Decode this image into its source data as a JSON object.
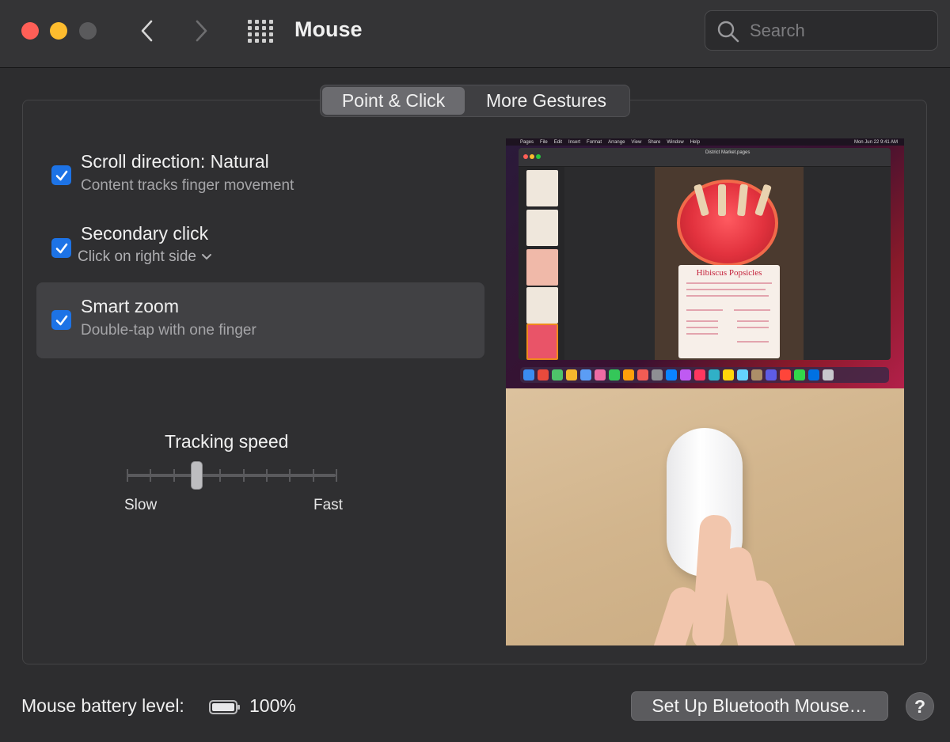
{
  "window": {
    "title": "Mouse",
    "search_placeholder": "Search"
  },
  "tabs": [
    {
      "label": "Point & Click",
      "active": true
    },
    {
      "label": "More Gestures",
      "active": false
    }
  ],
  "options": [
    {
      "title": "Scroll direction: Natural",
      "subtitle": "Content tracks finger movement",
      "checked": true
    },
    {
      "title": "Secondary click",
      "subtitle": "Click on right side",
      "checked": true,
      "has_dropdown": true
    },
    {
      "title": "Smart zoom",
      "subtitle": "Double-tap with one finger",
      "checked": true,
      "selected": true
    }
  ],
  "tracking": {
    "label": "Tracking speed",
    "min_label": "Slow",
    "max_label": "Fast",
    "ticks": 10,
    "position": 3
  },
  "preview": {
    "doc_title": "District Market.pages",
    "recipe_title": "Hibiscus Popsicles",
    "menu_items": [
      "Pages",
      "File",
      "Edit",
      "Insert",
      "Format",
      "Arrange",
      "View",
      "Share",
      "Window",
      "Help"
    ],
    "clock": "Mon Jun 22  9:41 AM"
  },
  "footer": {
    "battery_label": "Mouse battery level:",
    "battery_value": "100%",
    "setup_button": "Set Up Bluetooth Mouse…",
    "help_label": "?"
  },
  "colors": {
    "accent": "#1d73e6",
    "close": "#ff5f57",
    "minimize": "#febc2e"
  }
}
